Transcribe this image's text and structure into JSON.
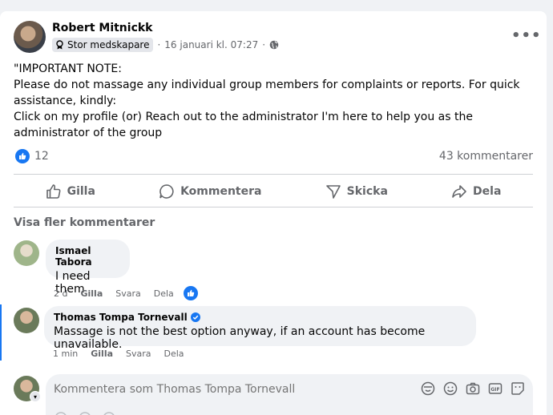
{
  "post": {
    "author": "Robert Mitnickk",
    "badge": "Stor medskapare",
    "timestamp": "16 januari kl. 07:27",
    "text": "\"IMPORTANT NOTE:\nPlease do not massage any individual group members for complaints or reports. For quick assistance, kindly:\nClick on my profile (or) Reach out to the administrator I'm here to help you as the administrator of the group",
    "like_count": "12",
    "comment_count": "43 kommentarer"
  },
  "actions": {
    "like": "Gilla",
    "comment": "Kommentera",
    "send": "Skicka",
    "share": "Dela"
  },
  "more_comments": "Visa fler kommentarer",
  "comments": [
    {
      "name": "Ismael Tabora",
      "text": "I need them",
      "time": "2 d",
      "like": "Gilla",
      "reply": "Svara",
      "share": "Dela"
    },
    {
      "name": "Thomas Tompa Tornevall",
      "text": "Massage is not the best option anyway, if an account has become unavailable.",
      "time": "1 min",
      "like": "Gilla",
      "reply": "Svara",
      "share": "Dela"
    }
  ],
  "composer": {
    "placeholder": "Kommentera som Thomas Tompa Tornevall"
  },
  "colors": {
    "accent": "#1877f2",
    "secondary_text": "#65676b",
    "bubble": "#f0f2f5"
  }
}
